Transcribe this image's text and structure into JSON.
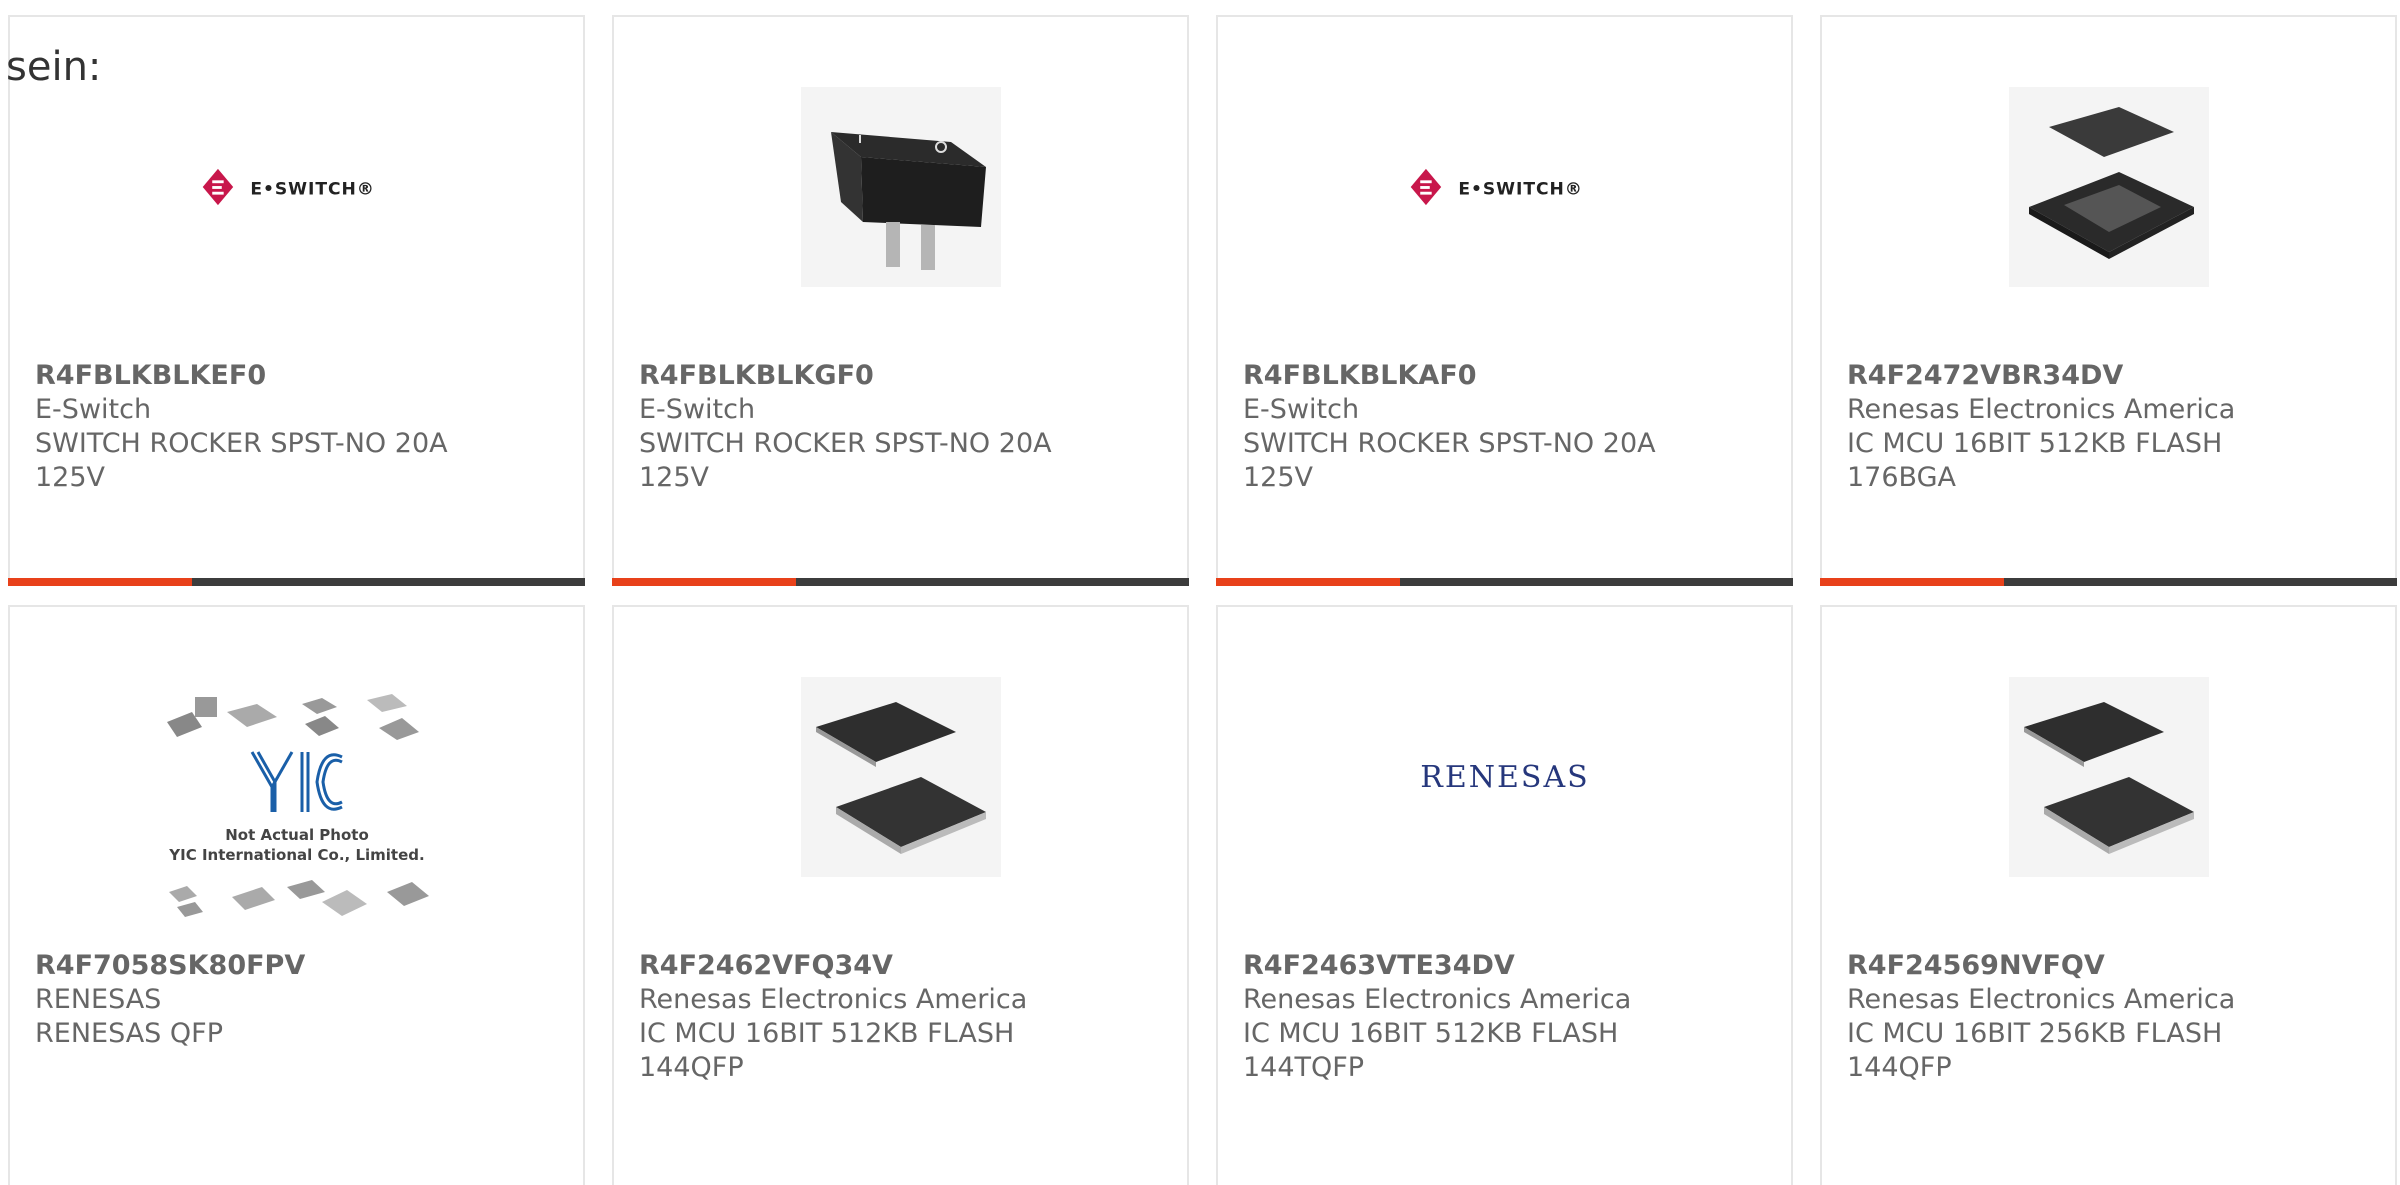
{
  "intro": "sein:",
  "colors": {
    "accent": "#e8411a",
    "bar": "#3c3c3c",
    "border": "#e6e6e6",
    "text": "#666666"
  },
  "cards": [
    {
      "part": "R4FBLKBLKEF0",
      "brand": "E-Switch",
      "desc1": "SWITCH ROCKER SPST-NO 20A",
      "desc2": "125V",
      "image": "e-switch-logo",
      "logo_text": "E•SWITCH®"
    },
    {
      "part": "R4FBLKBLKGF0",
      "brand": "E-Switch",
      "desc1": "SWITCH ROCKER SPST-NO 20A",
      "desc2": "125V",
      "image": "rocker-switch-photo"
    },
    {
      "part": "R4FBLKBLKAF0",
      "brand": "E-Switch",
      "desc1": "SWITCH ROCKER SPST-NO 20A",
      "desc2": "125V",
      "image": "e-switch-logo",
      "logo_text": "E•SWITCH®"
    },
    {
      "part": "R4F2472VBR34DV",
      "brand": "Renesas Electronics America",
      "desc1": "IC MCU 16BIT 512KB FLASH",
      "desc2": "176BGA",
      "image": "bga-chip-photo"
    },
    {
      "part": "R4F7058SK80FPV",
      "brand": "RENESAS",
      "desc1": "RENESAS QFP",
      "desc2": "",
      "image": "yic-placeholder",
      "logo_text": "YIC",
      "caption1": "Not Actual Photo",
      "caption2": "YIC International Co., Limited."
    },
    {
      "part": "R4F2462VFQ34V",
      "brand": "Renesas Electronics America",
      "desc1": "IC MCU 16BIT 512KB FLASH",
      "desc2": "144QFP",
      "image": "qfp-chip-photo"
    },
    {
      "part": "R4F2463VTE34DV",
      "brand": "Renesas Electronics America",
      "desc1": "IC MCU 16BIT 512KB FLASH",
      "desc2": "144TQFP",
      "image": "renesas-logo",
      "logo_text": "RENESAS"
    },
    {
      "part": "R4F24569NVFQV",
      "brand": "Renesas Electronics America",
      "desc1": "IC MCU 16BIT 256KB FLASH",
      "desc2": "144QFP",
      "image": "qfp-chip-photo"
    }
  ]
}
